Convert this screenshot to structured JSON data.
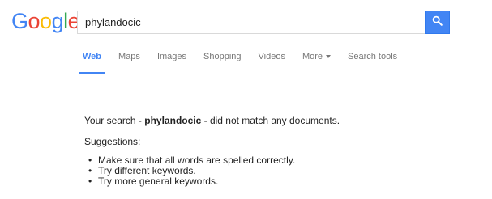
{
  "logo": {
    "text": "Google",
    "letters": [
      {
        "ch": "G",
        "color": "#4285f4"
      },
      {
        "ch": "o",
        "color": "#ea4335"
      },
      {
        "ch": "o",
        "color": "#fbbc05"
      },
      {
        "ch": "g",
        "color": "#4285f4"
      },
      {
        "ch": "l",
        "color": "#34a853"
      },
      {
        "ch": "e",
        "color": "#ea4335"
      }
    ]
  },
  "search": {
    "value": "phylandocic",
    "button_icon": "search-icon",
    "accent": "#4285f4"
  },
  "tabs": [
    {
      "label": "Web",
      "active": true
    },
    {
      "label": "Maps",
      "active": false
    },
    {
      "label": "Images",
      "active": false
    },
    {
      "label": "Shopping",
      "active": false
    },
    {
      "label": "Videos",
      "active": false
    },
    {
      "label": "More",
      "active": false,
      "dropdown": true
    },
    {
      "label": "Search tools",
      "active": false
    }
  ],
  "results": {
    "prefix": "Your search - ",
    "query": "phylandocic",
    "suffix": " - did not match any documents.",
    "suggestions_title": "Suggestions:",
    "suggestions": [
      "Make sure that all words are spelled correctly.",
      "Try different keywords.",
      "Try more general keywords."
    ]
  }
}
